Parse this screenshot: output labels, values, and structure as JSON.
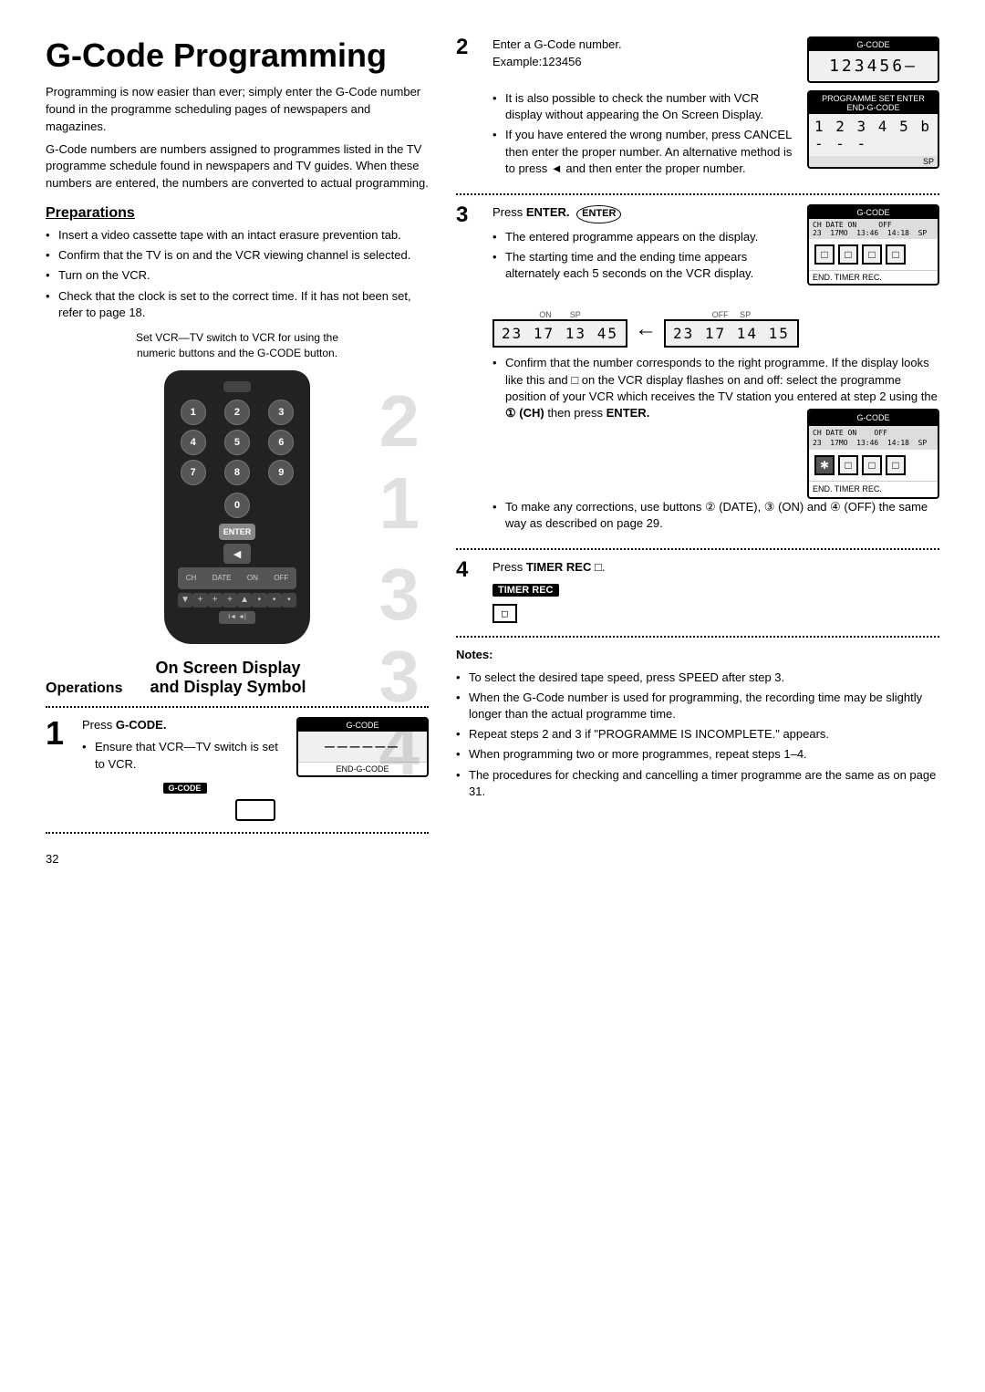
{
  "page": {
    "title": "G-Code Programming",
    "page_number": "32"
  },
  "intro": {
    "para1": "Programming is now easier than ever; simply enter the G-Code number found in the programme scheduling pages of newspapers and magazines.",
    "para2": "G-Code numbers are numbers assigned to programmes listed in the TV programme schedule found in newspapers and TV guides. When these numbers are entered, the numbers are converted to actual programming."
  },
  "preparations": {
    "heading": "Preparations",
    "items": [
      "Insert a video cassette tape with an intact erasure prevention tab.",
      "Confirm that the TV is on and the VCR viewing channel is selected.",
      "Turn on the VCR.",
      "Check that the clock is set to the correct time. If it has not been set, refer to page 18."
    ]
  },
  "remote_note": {
    "line1": "Set VCR—TV switch to VCR for using the",
    "line2": "numeric buttons and the G-CODE button."
  },
  "remote_buttons": {
    "row1": [
      "1",
      "2",
      "3"
    ],
    "row2": [
      "4",
      "5",
      "6"
    ],
    "row3": [
      "7",
      "8",
      "9"
    ],
    "zero": "0",
    "enter_label": "ENTER",
    "rew_label": "◄",
    "timer_label": "I◄ ◄|"
  },
  "step_labels": {
    "s1": "1",
    "s2": "2",
    "s3": "3",
    "s4": "4"
  },
  "step1": {
    "action": "Press G-CODE.",
    "bullet": "Ensure that VCR—TV switch is set to VCR.",
    "button_label": "G-CODE",
    "display_header": "G-CODE",
    "display_value": "——————",
    "display_footer": "END-G-CODE"
  },
  "step2": {
    "action": "Enter a G-Code number.",
    "example": "Example:123456",
    "display_header": "G-CODE",
    "display_value": "123456—",
    "display_footer2_header": "PROGRAMME SET ENTER END-G-CODE",
    "display_body": "1 2 3 4 5 6 - - -",
    "bullet1": "It is also possible to check the number with VCR display without appearing the On Screen Display.",
    "bullet2": "If you have entered the wrong number, press CANCEL then enter the proper number. An alternative method is to press ◄ and then enter the proper number.",
    "on_screen_display_value": "1 2 3 4 5 b - - -",
    "sp_label": "SP"
  },
  "step3": {
    "action": "Press ENTER.",
    "enter_badge": "ENTER",
    "bullet1": "The entered programme appears on the display.",
    "bullet2": "The starting time and the ending time appears alternately each 5 seconds on the VCR display.",
    "display_header": "G-CODE",
    "display_top": "CH DATE ON    OFF",
    "display_top2": "23  17MO  13:46  14:18  SP",
    "display_squares": [
      "□",
      "□",
      "□",
      "□"
    ],
    "display_footer": "END. TIMER REC.",
    "vcr_on_display": "23  17  13 45",
    "vcr_off_display": "23  17  14 15",
    "on_label": "ON",
    "sp_label": "SP",
    "off_label": "OFF",
    "bullet3": "Confirm that the number corresponds to the right programme. If the display looks like this and □ on the VCR display flashes on and off: select the programme position of your VCR which receives the TV station you entered at step 2 using the ① (CH) then press ENTER.",
    "display2_header": "G-CODE",
    "display2_top": "CH DATE ON    OFF",
    "display2_top2": "23  17MO  13:46  14:18  SP",
    "display2_footer": "END. TIMER REC.",
    "bullet4": "To make any corrections, use buttons ② (DATE), ③ (ON) and ④ (OFF) the same way as described on page 29."
  },
  "step4": {
    "action": "Press TIMER REC",
    "action_suffix": "□.",
    "badge_label": "TIMER REC",
    "box_label": "□"
  },
  "notes": {
    "heading": "Notes:",
    "items": [
      "To select the desired tape speed, press SPEED after step 3.",
      "When the G-Code number is used for programming, the recording time may be slightly longer than the actual programme time.",
      "Repeat steps 2 and 3 if \"PROGRAMME IS INCOMPLETE.\" appears.",
      "When programming two or more programmes, repeat steps 1–4.",
      "The procedures for checking and cancelling a timer programme are the same as on page 31."
    ]
  },
  "operations": {
    "label": "Operations",
    "on_screen_label": "On Screen Display",
    "on_screen_label2": "and Display Symbol"
  }
}
